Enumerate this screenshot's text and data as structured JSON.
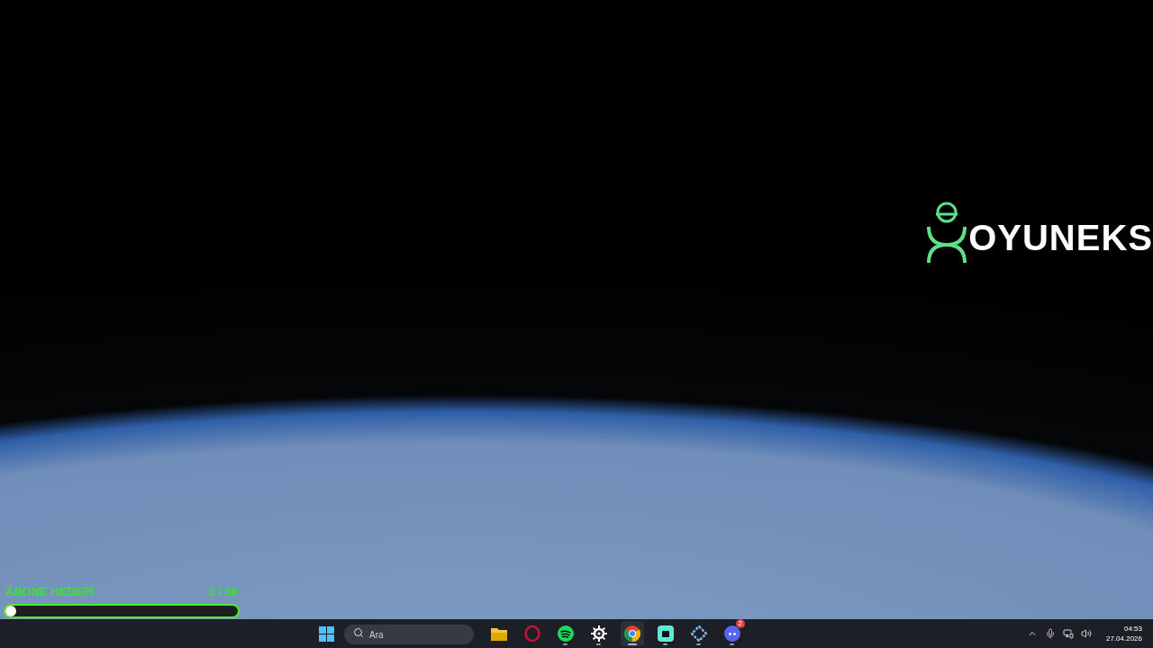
{
  "overlay": {
    "logo": "OYUNEKS",
    "goal": {
      "label": "ABONE HEDEFİ",
      "count": "2 / 50",
      "level": 0.04
    }
  },
  "taskbar": {
    "search": {
      "placeholder": "Ara"
    },
    "apps": [
      {
        "kind": "files",
        "running": false,
        "active": false
      },
      {
        "kind": "opera",
        "running": false,
        "active": false
      },
      {
        "kind": "spotify",
        "running": true,
        "active": false
      },
      {
        "kind": "steelseries",
        "running": true,
        "active": false
      },
      {
        "kind": "chrome",
        "running": true,
        "active": true
      },
      {
        "kind": "green-app",
        "running": true,
        "active": false
      },
      {
        "kind": "blue-app",
        "running": true,
        "active": false
      },
      {
        "kind": "discord",
        "running": true,
        "active": false,
        "badge": "2"
      }
    ],
    "clock": {
      "time": "04:53",
      "date": "27.04.2026"
    }
  }
}
